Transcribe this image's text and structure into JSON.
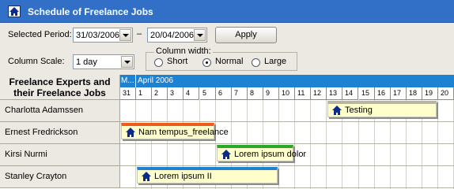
{
  "window": {
    "title": "Schedule of Freelance Jobs",
    "icon": "home-icon"
  },
  "toolbar": {
    "period_label": "Selected Period:",
    "start_date": "31/03/2006",
    "separator": "–",
    "end_date": "20/04/2006",
    "apply_label": "Apply",
    "scale_label": "Column Scale:",
    "scale_value": "1 day",
    "width_group_label": "Column width:",
    "width_options": [
      "Short",
      "Normal",
      "Large"
    ],
    "width_selected": "Normal"
  },
  "grid": {
    "resource_header": "Freelance Experts and their Freelance Jobs",
    "month_prev": "M...",
    "month_current": "April 2006",
    "days": [
      "31",
      "1",
      "2",
      "3",
      "4",
      "5",
      "6",
      "7",
      "8",
      "9",
      "10",
      "11",
      "12",
      "13",
      "14",
      "15",
      "16",
      "17",
      "18",
      "19",
      "20"
    ],
    "resources": [
      {
        "name": "Charlotta Adamssen"
      },
      {
        "name": "Ernest Fredrickson"
      },
      {
        "name": "Kirsi Nurmi"
      },
      {
        "name": "Stanley Crayton"
      }
    ],
    "tasks": [
      {
        "label": "Testing",
        "row": 0,
        "start_day_index": 13,
        "end_day_index": 20,
        "color": "#b7b4a8"
      },
      {
        "label": "Nam tempus_freelance",
        "row": 1,
        "start_day_index": 0,
        "end_day_index": 6,
        "color": "#f05a1e"
      },
      {
        "label": "Lorem ipsum dolor",
        "row": 2,
        "start_day_index": 6,
        "end_day_index": 11,
        "color": "#2aa82a"
      },
      {
        "label": "Lorem ipsum II",
        "row": 3,
        "start_day_index": 1,
        "end_day_index": 10,
        "color": "#1e82d2"
      }
    ]
  },
  "colors": {
    "titlebar": "#3170c6",
    "month_band": "#1e82d2",
    "task_fill": "#ffffcc"
  }
}
